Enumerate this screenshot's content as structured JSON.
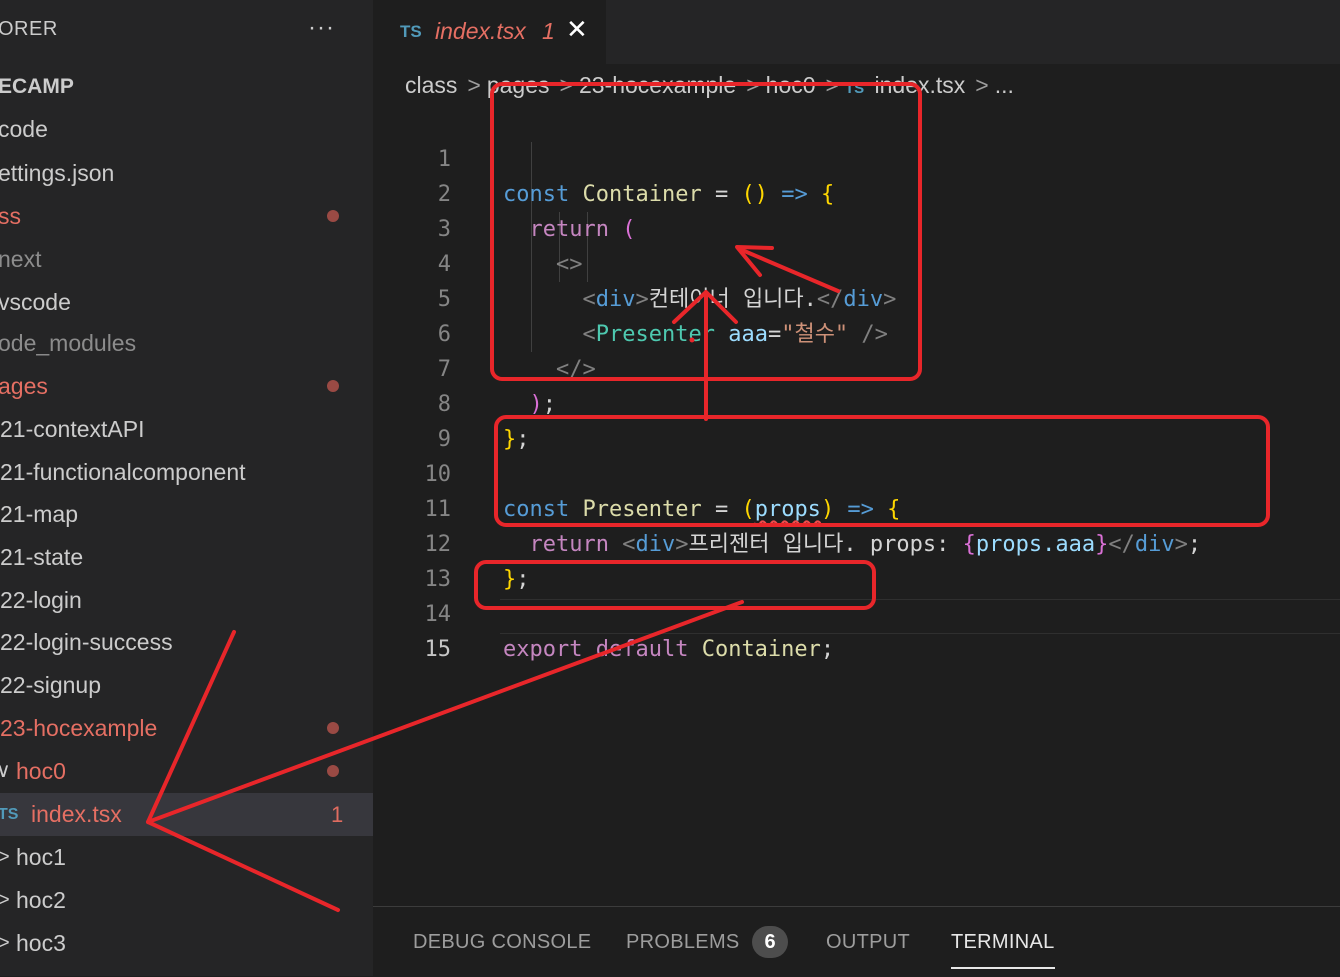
{
  "sidebar": {
    "header": "ORER",
    "more_label": "···",
    "items": [
      {
        "label": "ECAMP",
        "style": "bold"
      },
      {
        "label": "code"
      },
      {
        "label": "ettings.json"
      },
      {
        "label": "ss",
        "modified": true
      },
      {
        "label": "next",
        "dim": true
      },
      {
        "label": "vscode"
      },
      {
        "label": "ode_modules",
        "dim": true
      },
      {
        "label": "ages",
        "modified": true
      },
      {
        "label": "21-contextAPI"
      },
      {
        "label": "21-functionalcomponent"
      },
      {
        "label": "21-map"
      },
      {
        "label": "21-state"
      },
      {
        "label": "22-login"
      },
      {
        "label": "22-login-success"
      },
      {
        "label": "22-signup"
      },
      {
        "label": "23-hocexample",
        "modified": true
      },
      {
        "label": "hoc0",
        "chevron": "∨",
        "modified": true
      },
      {
        "label": "index.tsx",
        "icon": "TS",
        "count": "1",
        "selected": true
      },
      {
        "label": "hoc1",
        "chevron": ">"
      },
      {
        "label": "hoc2",
        "chevron": ">"
      },
      {
        "label": "hoc3",
        "chevron": ">"
      }
    ]
  },
  "tab": {
    "icon": "TS",
    "name": "index.tsx",
    "problems": "1",
    "close": "✕"
  },
  "breadcrumb": [
    "class",
    "pages",
    "23-hocexample",
    "hoc0",
    "index.tsx",
    "..."
  ],
  "breadcrumb_ts": "TS",
  "code": {
    "line_numbers": [
      "1",
      "2",
      "3",
      "4",
      "5",
      "6",
      "7",
      "8",
      "9",
      "10",
      "11",
      "12",
      "13",
      "14",
      "15"
    ],
    "l1": {
      "kw": "const",
      "name": "Container",
      "eq": " = ",
      "paren": "()",
      "arrow": " => ",
      "brace": "{"
    },
    "l2": {
      "kw": "return",
      "paren": "("
    },
    "l3": {
      "frag": "<>"
    },
    "l4": {
      "open": "<",
      "tag": "div",
      "close": ">",
      "text": "컨테이너 입니다.",
      "end_open": "</",
      "end_tag": "div",
      "end_close": ">"
    },
    "l5": {
      "open": "<",
      "comp": "Presenter",
      "attr": "aaa",
      "eq": "=",
      "value": "\"철수\"",
      "selfclose": " />"
    },
    "l6": {
      "frag": "</>"
    },
    "l7": {
      "paren": ")",
      "semi": ";"
    },
    "l8": {
      "brace": "}",
      "semi": ";"
    },
    "l10": {
      "kw": "const",
      "name": "Presenter",
      "eq": " = ",
      "po": "(",
      "param": "props",
      "pc": ")",
      "arrow": " => ",
      "brace": "{"
    },
    "l11": {
      "kw": "return",
      "open": "<",
      "tag": "div",
      "close": ">",
      "text": "프리젠터 입니다. props: ",
      "bo": "{",
      "expr": "props.aaa",
      "bc": "}",
      "end_open": "</",
      "end_tag": "div",
      "end_close": ">",
      "semi": ";"
    },
    "l12": {
      "brace": "}",
      "semi": ";"
    },
    "l14": {
      "kw1": "export",
      "kw2": "default",
      "name": "Container",
      "semi": ";"
    }
  },
  "panel": {
    "tabs": [
      "DEBUG CONSOLE",
      "PROBLEMS",
      "OUTPUT",
      "TERMINAL"
    ],
    "problems_count": "6",
    "active": "TERMINAL"
  },
  "annotation_color": "#e8262a"
}
